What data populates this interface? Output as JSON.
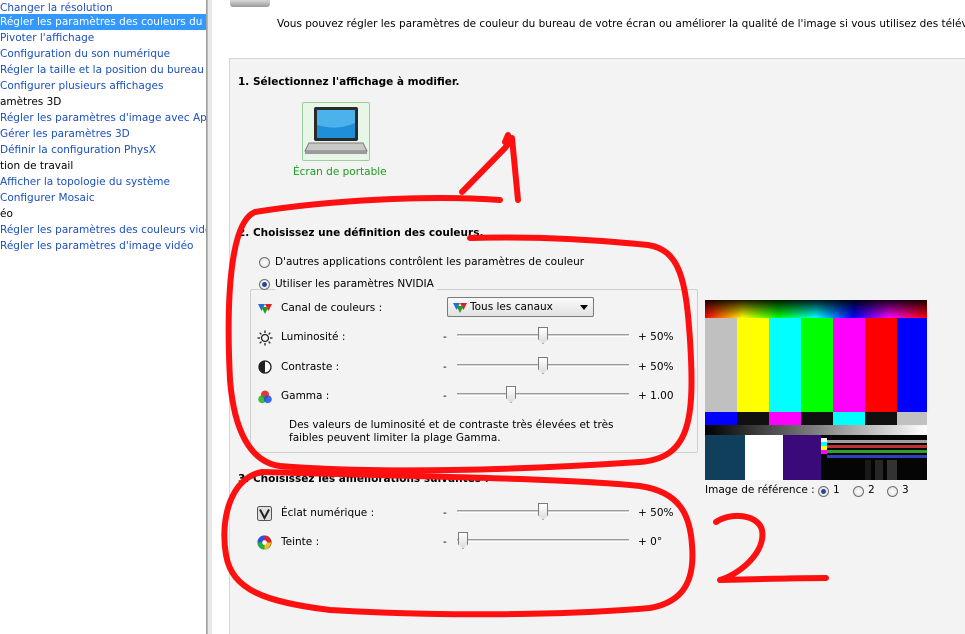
{
  "sidebar": {
    "items": [
      {
        "label": "Changer la résolution",
        "type": "link",
        "selected": false
      },
      {
        "label": "Régler les paramètres des couleurs du bureau",
        "type": "link",
        "selected": true
      },
      {
        "label": "Pivoter l'affichage",
        "type": "link",
        "selected": false
      },
      {
        "label": "Configuration du son numérique",
        "type": "link",
        "selected": false
      },
      {
        "label": "Régler la taille et la position du bureau",
        "type": "link",
        "selected": false
      },
      {
        "label": "Configurer plusieurs affichages",
        "type": "link",
        "selected": false
      },
      {
        "label": "amètres 3D",
        "type": "category",
        "selected": false
      },
      {
        "label": "Régler les paramètres d'image avec Aperçu",
        "type": "link",
        "selected": false
      },
      {
        "label": "Gérer les paramètres 3D",
        "type": "link",
        "selected": false
      },
      {
        "label": "Définir la configuration PhysX",
        "type": "link",
        "selected": false
      },
      {
        "label": "tion de travail",
        "type": "category",
        "selected": false
      },
      {
        "label": "Afficher la topologie du système",
        "type": "link",
        "selected": false
      },
      {
        "label": "Configurer Mosaic",
        "type": "link",
        "selected": false
      },
      {
        "label": "éo",
        "type": "category",
        "selected": false
      },
      {
        "label": "Régler les paramètres des couleurs vidéo",
        "type": "link",
        "selected": false
      },
      {
        "label": "Régler les paramètres d'image vidéo",
        "type": "link",
        "selected": false
      }
    ]
  },
  "header": {
    "description": "Vous pouvez régler les paramètres de couleur du bureau de votre écran ou améliorer la qualité de l'image si vous utilisez des téléviseurs"
  },
  "section1": {
    "title": "1. Sélectionnez l'affichage à modifier.",
    "display_label": "Écran de portable",
    "display_icon": "laptop-icon"
  },
  "section2": {
    "title": "2. Choisissez une définition des couleurs.",
    "radio_other": "D'autres applications contrôlent les paramètres de couleur",
    "radio_nvidia": "Utiliser les paramètres NVIDIA",
    "selected_option": "Utiliser les paramètres NVIDIA",
    "channel": {
      "label": "Canal de couleurs :",
      "value": "Tous les canaux"
    },
    "sliders": [
      {
        "label": "Luminosité :",
        "minus": "-",
        "value_text": "+ 50%",
        "fraction": 0.5
      },
      {
        "label": "Contraste :",
        "minus": "-",
        "value_text": "+ 50%",
        "fraction": 0.5
      },
      {
        "label": "Gamma :",
        "minus": "-",
        "value_text": "+ 1.00",
        "fraction": 0.3
      }
    ],
    "note_line1": "Des valeurs de luminosité et de contraste très élevées et très",
    "note_line2": "faibles peuvent limiter la plage Gamma."
  },
  "section3": {
    "title": "3. Choisissez les améliorations suivantes :",
    "sliders": [
      {
        "label": "Éclat numérique :",
        "minus": "-",
        "value_text": "+ 50%",
        "fraction": 0.5
      },
      {
        "label": "Teinte :",
        "minus": "-",
        "value_text": "+ 0°",
        "fraction": 0.0
      }
    ]
  },
  "reference": {
    "label": "Image de référence :",
    "options": [
      "1",
      "2",
      "3"
    ],
    "selected": "1"
  },
  "colors": {
    "selected_bg": "#3399ff",
    "link": "#1a4fbf",
    "annotation": "#ff1010",
    "display_label": "#1c9c1c"
  },
  "annotation_marks": [
    "2"
  ]
}
